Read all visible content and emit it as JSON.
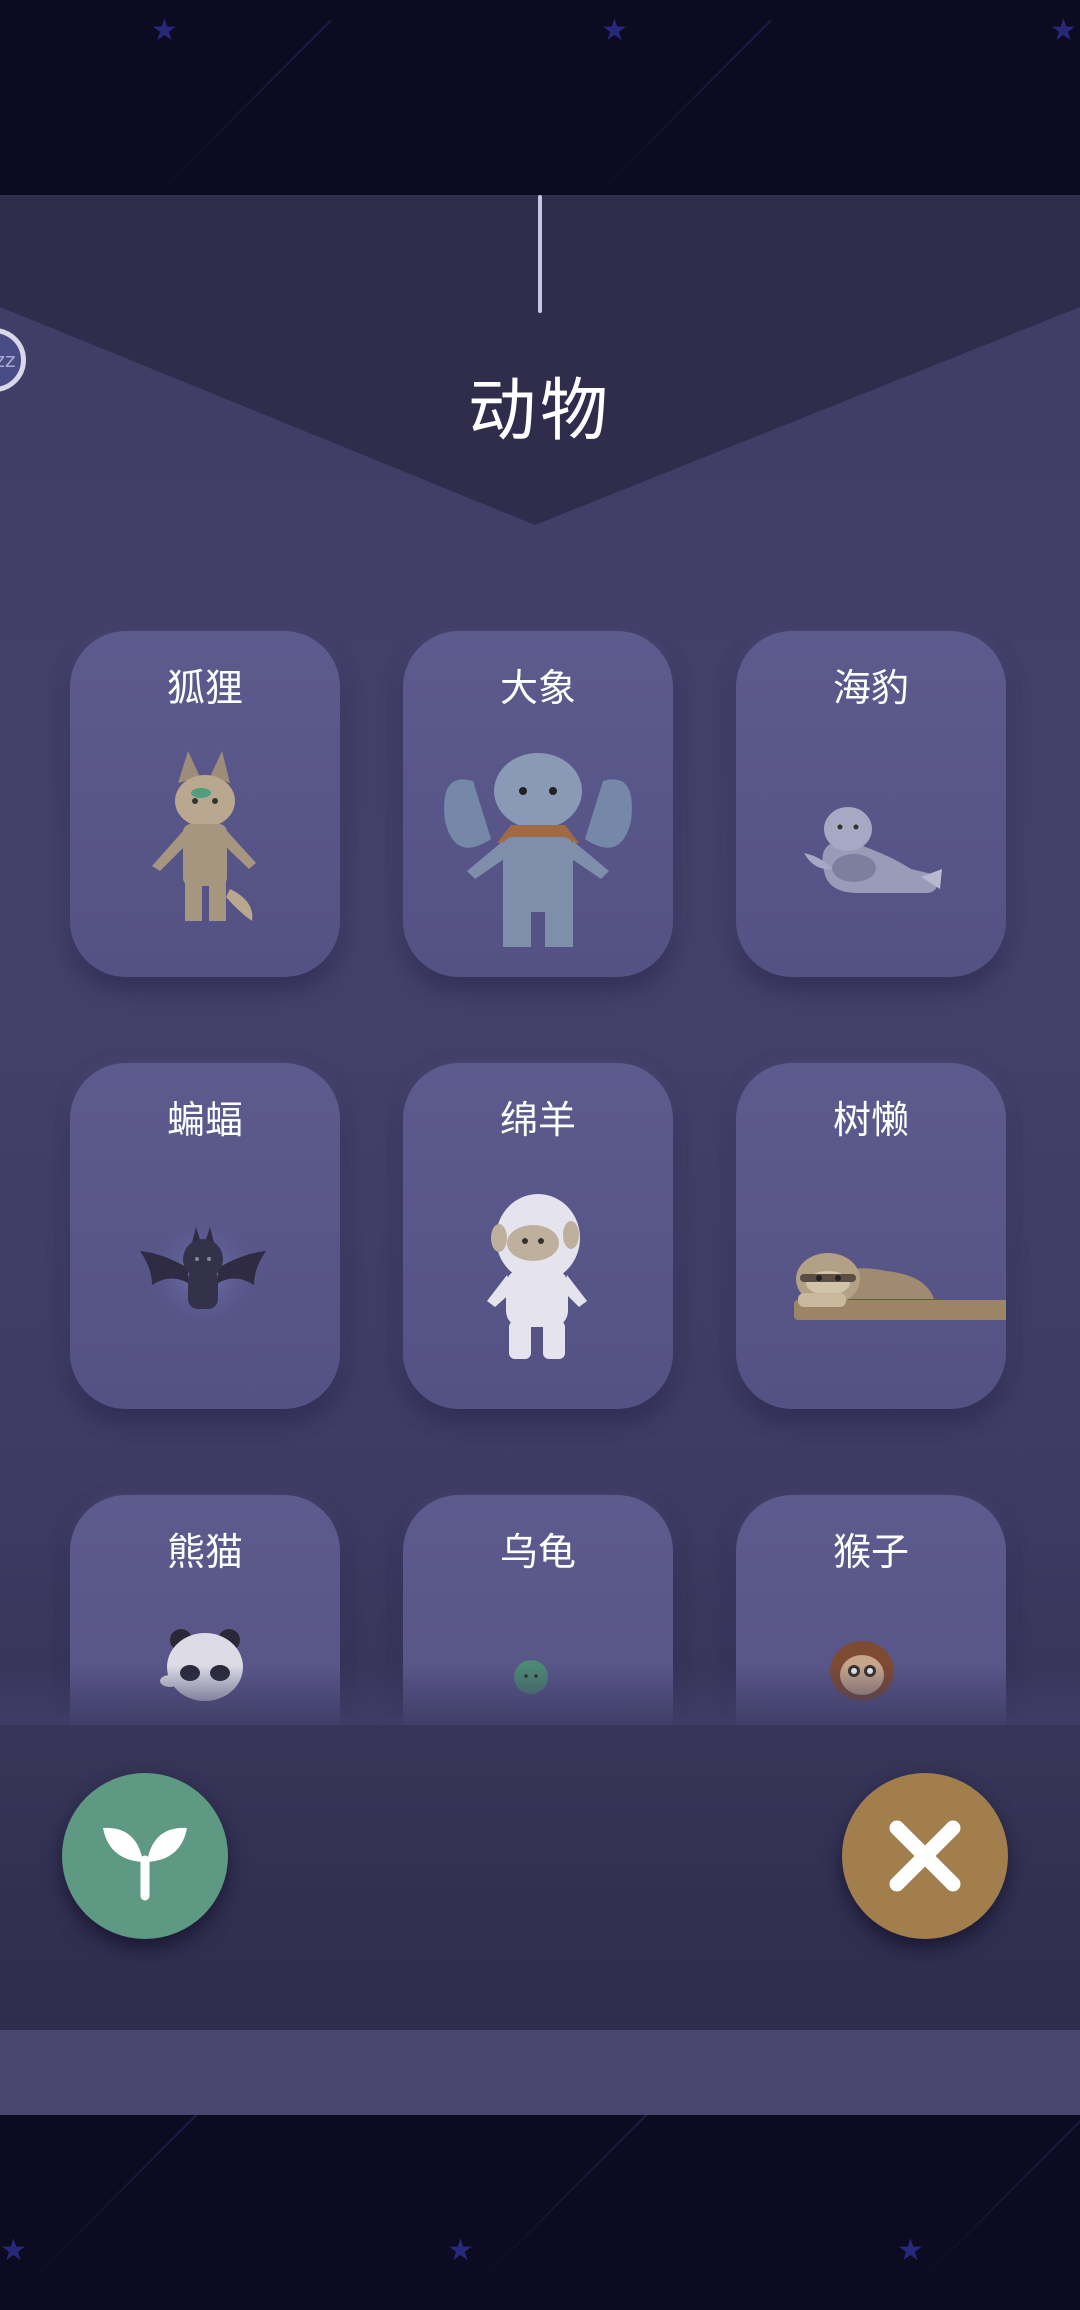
{
  "panel": {
    "title": "动物",
    "sleep_badge": "zz"
  },
  "cards": [
    {
      "label": "狐狸",
      "icon": "fox-icon"
    },
    {
      "label": "大象",
      "icon": "elephant-icon"
    },
    {
      "label": "海豹",
      "icon": "seal-icon"
    },
    {
      "label": "蝙蝠",
      "icon": "bat-icon"
    },
    {
      "label": "绵羊",
      "icon": "sheep-icon"
    },
    {
      "label": "树懒",
      "icon": "sloth-icon"
    },
    {
      "label": "熊猫",
      "icon": "panda-icon"
    },
    {
      "label": "乌龟",
      "icon": "turtle-icon"
    },
    {
      "label": "猴子",
      "icon": "monkey-icon"
    }
  ],
  "buttons": {
    "plant_icon": "sprout-icon",
    "close_icon": "close-icon"
  },
  "colors": {
    "background": "#0c0b22",
    "panel": "#434169",
    "card": "#5a5789",
    "plant_button": "#5e9a83",
    "close_button": "#a17e4c"
  }
}
